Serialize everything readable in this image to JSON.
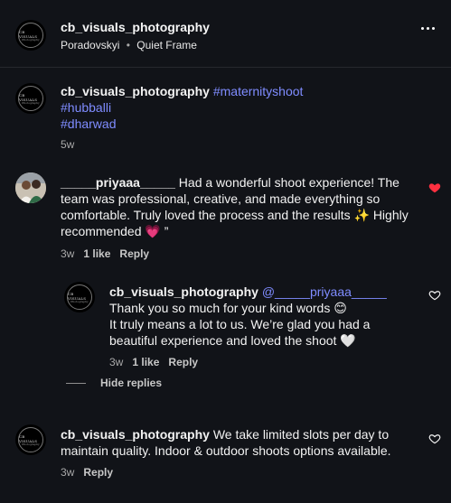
{
  "header": {
    "username": "cb_visuals_photography",
    "subtitle": "Poradovskyi",
    "audio": "Quiet Frame",
    "separator": "•"
  },
  "logo": {
    "line1": "CB VISUALS",
    "line2": "Photography"
  },
  "caption": {
    "username": "cb_visuals_photography",
    "hashtags": [
      "#maternityshoot",
      "#hubballi",
      "#dharwad"
    ],
    "time": "5w"
  },
  "comments": [
    {
      "username": "_____priyaaa_____",
      "text": "Had a wonderful shoot experience! The team was professional, creative, and made everything so comfortable. Truly loved the process and the results ✨ Highly recommended 💗 ”",
      "time": "3w",
      "likes": "1 like",
      "reply_label": "Reply",
      "liked": true
    },
    {
      "username": "cb_visuals_photography",
      "mention": "@_____priyaaa_____",
      "text_after_mention": " Thank you so much for your kind words 😊",
      "text_line2": "It truly means a lot to us. We’re glad you had a beautiful experience and loved the shoot 🤍",
      "time": "3w",
      "likes": "1 like",
      "reply_label": "Reply",
      "liked": false
    },
    {
      "username": "cb_visuals_photography",
      "text": "We take limited slots per day to maintain quality. Indoor & outdoor shoots options available.",
      "time": "3w",
      "reply_label": "Reply",
      "liked": false
    }
  ],
  "hide_replies": "Hide replies",
  "colors": {
    "background": "#111318",
    "link": "#7f8cff",
    "like_red": "#ff3040"
  }
}
